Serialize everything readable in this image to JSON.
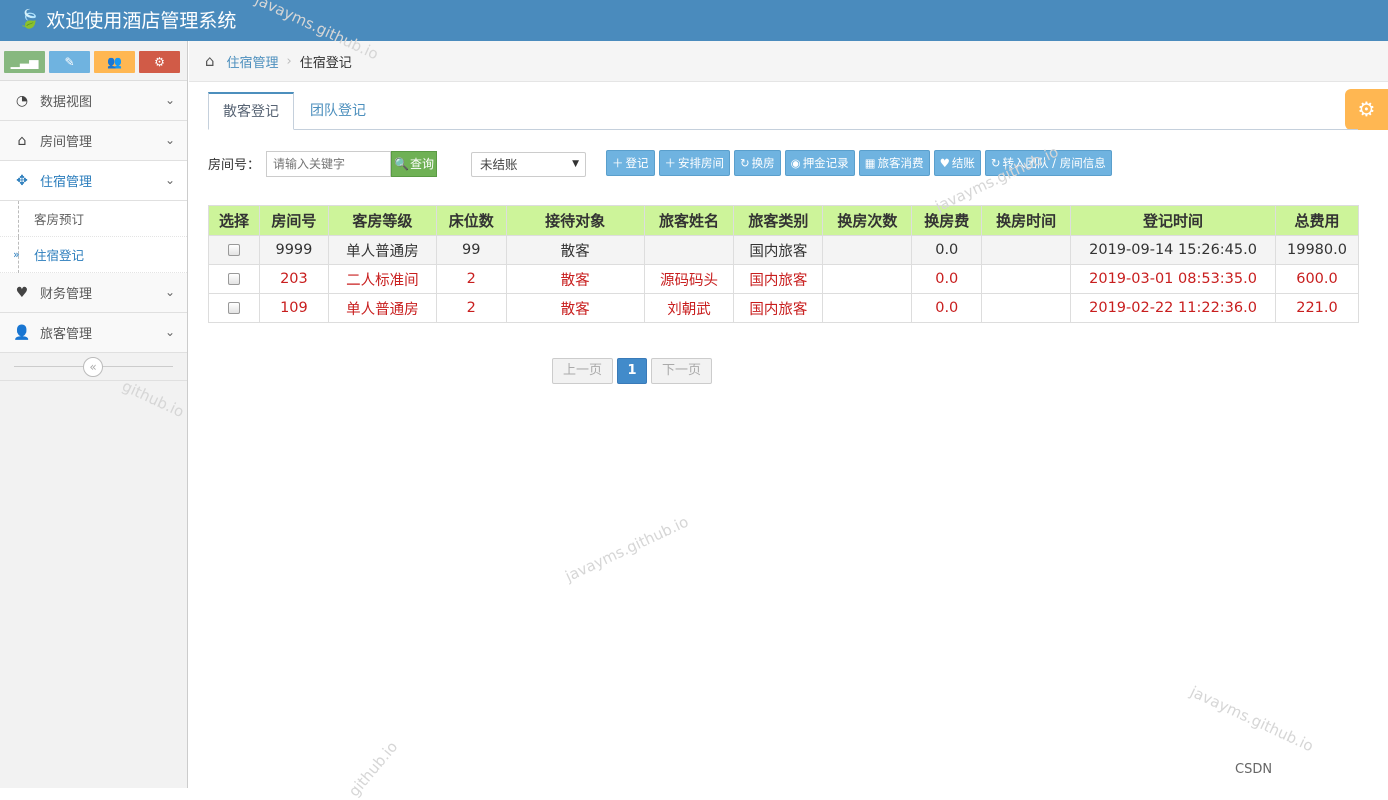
{
  "app": {
    "title": "欢迎使用酒店管理系统"
  },
  "sidebar": {
    "items": [
      {
        "label": "数据视图"
      },
      {
        "label": "房间管理"
      },
      {
        "label": "住宿管理"
      },
      {
        "label": "财务管理"
      },
      {
        "label": "旅客管理"
      }
    ],
    "sub_items": [
      {
        "label": "客房预订"
      },
      {
        "label": "住宿登记"
      }
    ]
  },
  "breadcrumb": {
    "parent": "住宿管理",
    "current": "住宿登记"
  },
  "tabs": [
    {
      "label": "散客登记"
    },
    {
      "label": "团队登记"
    }
  ],
  "search": {
    "label": "房间号：",
    "placeholder": "请输入关键字",
    "button": "查询"
  },
  "filter": {
    "selected": "未结账"
  },
  "actions": [
    "登记",
    "安排房间",
    "换房",
    "押金记录",
    "旅客消费",
    "结账",
    "转入团队 / 房间信息"
  ],
  "table": {
    "headers": [
      "选择",
      "房间号",
      "客房等级",
      "床位数",
      "接待对象",
      "旅客姓名",
      "旅客类别",
      "换房次数",
      "换房费",
      "换房时间",
      "登记时间",
      "总费用"
    ],
    "rows": [
      [
        "",
        "9999",
        "单人普通房",
        "99",
        "散客",
        "",
        "国内旅客",
        "",
        "0.0",
        "",
        "2019-09-14 15:26:45.0",
        "19980.0"
      ],
      [
        "",
        "203",
        "二人标准间",
        "2",
        "散客",
        "源码码头",
        "国内旅客",
        "",
        "0.0",
        "",
        "2019-03-01 08:53:35.0",
        "600.0"
      ],
      [
        "",
        "109",
        "单人普通房",
        "2",
        "散客",
        "刘朝武",
        "国内旅客",
        "",
        "0.0",
        "",
        "2019-02-22 11:22:36.0",
        "221.0"
      ]
    ]
  },
  "pager": {
    "prev": "上一页",
    "current": "1",
    "next": "下一页"
  },
  "watermarks": [
    "javayms.github.io",
    "javayms.github.io",
    "javayms.github.io",
    "github.io",
    "github.io",
    "javayms.github.io"
  ],
  "footer_mark": "CSDN",
  "colors": {
    "topbar": "#4a8bbd",
    "header_row": "#cdf49a",
    "highlight_text": "#c81e1e",
    "action_button": "#6fb3e0",
    "query_button": "#6fb155",
    "settings": "#ffb752"
  }
}
